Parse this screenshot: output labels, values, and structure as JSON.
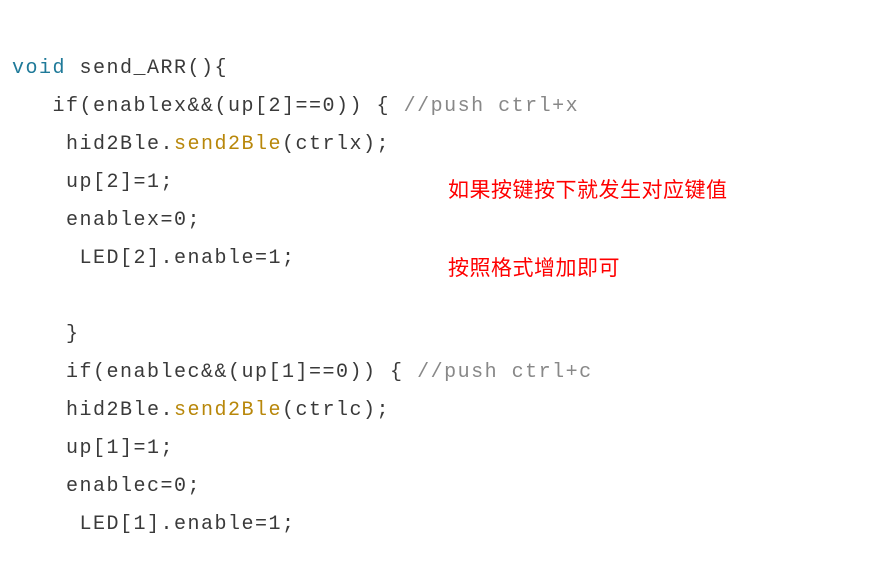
{
  "code": {
    "l1a": "void",
    "l1b": " send_ARR(){",
    "l2a": "   if(enablex&&(up[2]==0)) { ",
    "l2b": "//push ctrl+x",
    "l3a": "    hid2Ble.",
    "l3b": "send2Ble",
    "l3c": "(ctrlx);",
    "l4": "    up[2]=1;",
    "l5": "    enablex=0;",
    "l6": "     LED[2].enable=1;",
    "l7": "",
    "l8": "    }",
    "l9a": "    if(enablec&&(up[1]==0)) { ",
    "l9b": "//push ctrl+c",
    "l10a": "    hid2Ble.",
    "l10b": "send2Ble",
    "l10c": "(ctrlc);",
    "l11": "    up[1]=1;",
    "l12": "    enablec=0;",
    "l13": "     LED[1].enable=1;"
  },
  "notes": {
    "n1": "如果按键按下就发生对应键值",
    "n2": "按照格式增加即可"
  }
}
